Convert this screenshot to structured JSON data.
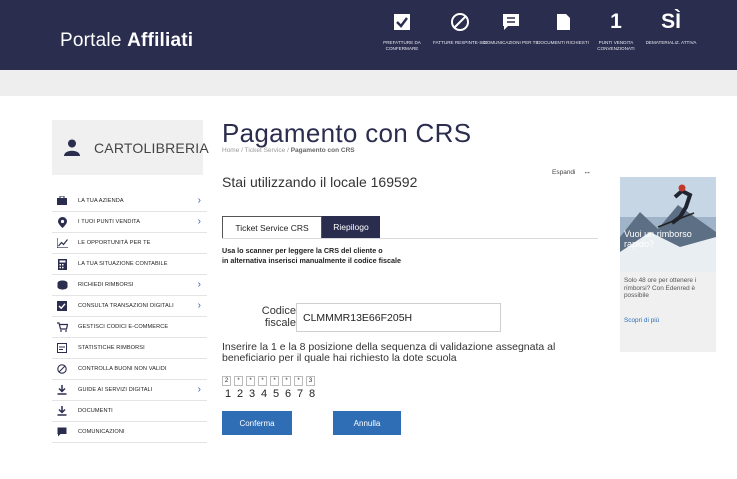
{
  "header": {
    "brand_light": "Portale",
    "brand_bold": "Affiliati",
    "nav": [
      {
        "icon": "check-icon",
        "label": "PREFATTURE DA CONFERMARE"
      },
      {
        "icon": "prohibited-icon",
        "label": "FATTURE RESPINTE-SDI"
      },
      {
        "icon": "message-icon",
        "label": "COMUNICAZIONI PER TE"
      },
      {
        "icon": "document-icon",
        "label": "DOCUMENTI RICHIESTI"
      },
      {
        "value": "1",
        "label": "PUNTI VENDITA CONVENZIONATI"
      },
      {
        "value": "SÌ",
        "label": "DEMATERIALIZ. ATTIVA"
      }
    ]
  },
  "sidebar": {
    "account_name": "CARTOLIBRERIA",
    "items": [
      {
        "label": "LA TUA AZIENDA",
        "icon": "briefcase-icon"
      },
      {
        "label": "I TUOI PUNTI VENDITA",
        "icon": "location-pin-icon"
      },
      {
        "label": "LE OPPORTUNITÀ PER TE",
        "icon": "trend-chart-icon"
      },
      {
        "label": "LA TUA SITUAZIONE CONTABILE",
        "icon": "calculator-icon"
      },
      {
        "label": "RICHIEDI RIMBORSI",
        "icon": "coins-icon"
      },
      {
        "label": "CONSULTA TRANSAZIONI DIGITALI",
        "icon": "check-square-icon"
      },
      {
        "label": "GESTISCI CODICI E-COMMERCE",
        "icon": "cart-icon"
      },
      {
        "label": "STATISTICHE RIMBORSI",
        "icon": "stats-icon"
      },
      {
        "label": "CONTROLLA BUONI NON VALIDI",
        "icon": "prohibited-icon"
      },
      {
        "label": "GUIDE AI SERVIZI DIGITALI",
        "icon": "download-icon"
      },
      {
        "label": "DOCUMENTI",
        "icon": "download-icon"
      },
      {
        "label": "COMUNICAZIONI",
        "icon": "message-icon"
      }
    ]
  },
  "main": {
    "title": "Pagamento con CRS",
    "breadcrumb_home": "Home",
    "breadcrumb_sep": "/",
    "breadcrumb_section": "Ticket Service",
    "breadcrumb_current": "Pagamento con CRS",
    "expand_label": "Espandi",
    "locale_text": "Stai utilizzando il locale 169592",
    "tabs": [
      {
        "label": "Ticket Service CRS"
      },
      {
        "label": "Riepilogo"
      }
    ],
    "instruction_line1": "Usa lo scanner per leggere la CRS del cliente o",
    "instruction_line2": "in alternativa inserisci manualmente il codice fiscale",
    "codice_label_1": "Codice",
    "codice_label_2": "fiscale",
    "codice_value": "CLMMMR13E66F205H",
    "validation_text": "Inserire la 1 e la 8 posizione della sequenza di validazione assegnata al beneficiario per il quale hai richiesto la dote scuola",
    "code_boxes": [
      "2",
      "*",
      "*",
      "*",
      "*",
      "*",
      "*",
      "3"
    ],
    "code_positions": [
      "1",
      "2",
      "3",
      "4",
      "5",
      "6",
      "7",
      "8"
    ],
    "confirm_label": "Conferma",
    "cancel_label": "Annulla"
  },
  "promo": {
    "overlay_text": "Vuoi un rimborso rapido?",
    "body_text": "Solo 48 ore per ottenere i rimborsi? Con Edenred è possibile",
    "link_text": "Scopri di più"
  },
  "colors": {
    "header_bg": "#2b2d4f",
    "accent_blue": "#2f6eb5",
    "sidebar_card_bg": "#f0f0f0"
  }
}
